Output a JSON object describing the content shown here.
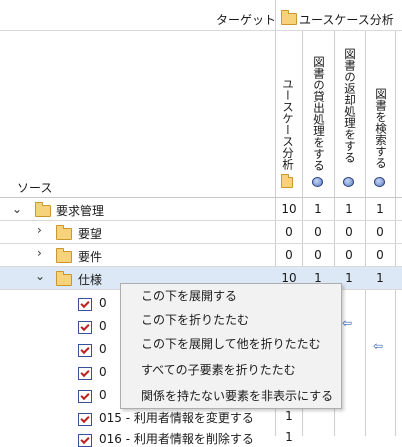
{
  "header": {
    "target_label": "ターゲット",
    "source_label": "ソース",
    "target_group": "ユースケース分析"
  },
  "columns": [
    {
      "label": "ユースケース分析",
      "icon": "folder-icon"
    },
    {
      "label": "図書の貸出処理をする",
      "icon": "usecase-icon"
    },
    {
      "label": "図書の返却処理をする",
      "icon": "usecase-icon"
    },
    {
      "label": "図書を検索する",
      "icon": "usecase-icon"
    }
  ],
  "rows": [
    {
      "label": "要求管理",
      "values": [
        "10",
        "1",
        "1",
        "1"
      ]
    },
    {
      "label": "要望",
      "values": [
        "0",
        "0",
        "0",
        "0"
      ]
    },
    {
      "label": "要件",
      "values": [
        "0",
        "0",
        "0",
        "0"
      ]
    },
    {
      "label": "仕様",
      "values": [
        "10",
        "1",
        "1",
        "1"
      ]
    }
  ],
  "child_rows": [
    {
      "label": "0",
      "value": ""
    },
    {
      "label": "0",
      "value": ""
    },
    {
      "label": "0",
      "value": ""
    },
    {
      "label": "0",
      "value": ""
    },
    {
      "label": "0",
      "value": ""
    },
    {
      "label": "015 - 利用者情報を変更する",
      "value": "1"
    },
    {
      "label": "016 - 利用者情報を削除する",
      "value": "1"
    }
  ],
  "context_menu": {
    "items": [
      "この下を展開する",
      "この下を折りたたむ",
      "この下を展開して他を折りたたむ",
      "すべての子要素を折りたたむ",
      "関係を持たない要素を非表示にする"
    ]
  },
  "colors": {
    "selected_row": "#dce8f5",
    "arrow": "#3b63b8",
    "folder": "#f6d27a"
  }
}
